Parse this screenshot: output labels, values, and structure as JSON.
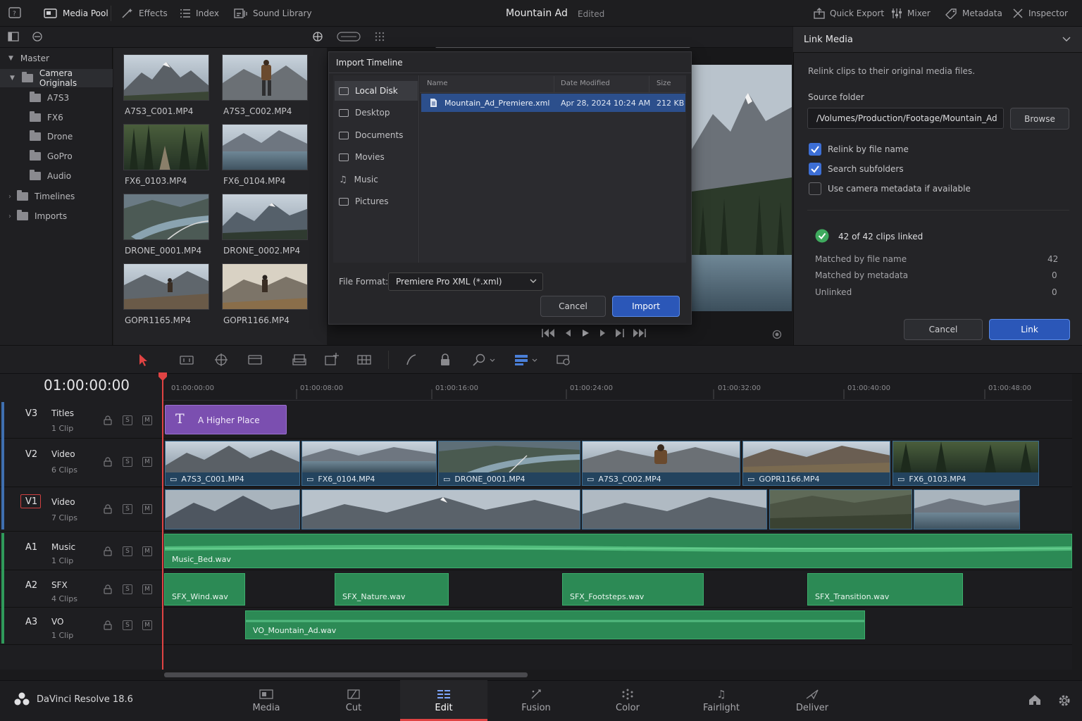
{
  "topbar": {
    "items": [
      {
        "label": "Media Pool",
        "icon": "media-pool-icon",
        "active": true
      },
      {
        "label": "Effects",
        "icon": "effects-icon"
      },
      {
        "label": "Index",
        "icon": "index-icon"
      },
      {
        "label": "Sound Library",
        "icon": "sound-library-icon"
      }
    ],
    "project_title": "Mountain Ad",
    "project_status": "Edited",
    "right_items": [
      {
        "label": "Quick Export",
        "icon": "quick-export-icon"
      },
      {
        "label": "Mixer",
        "icon": "mixer-icon"
      },
      {
        "label": "Metadata",
        "icon": "metadata-icon"
      },
      {
        "label": "Inspector",
        "icon": "inspector-icon"
      }
    ]
  },
  "bins": {
    "master": "Master",
    "items": [
      {
        "label": "Camera Originals",
        "selected": true
      },
      {
        "label": "A7S3"
      },
      {
        "label": "FX6"
      },
      {
        "label": "Drone"
      },
      {
        "label": "GoPro"
      },
      {
        "label": "Audio"
      },
      {
        "label": "Timelines"
      },
      {
        "label": "Imports"
      }
    ]
  },
  "pool": {
    "clips": [
      "A7S3_C001.MP4",
      "A7S3_C002.MP4",
      "FX6_0103.MP4",
      "FX6_0104.MP4",
      "DRONE_0001.MP4",
      "DRONE_0002.MP4",
      "GOPR1165.MP4",
      "GOPR1166.MP4"
    ]
  },
  "dialog": {
    "title": "Import Timeline",
    "locations": [
      "Local Disk",
      "Desktop",
      "Documents",
      "Movies",
      "Music",
      "Pictures"
    ],
    "columns": {
      "name": "Name",
      "date": "Date Modified",
      "size": "Size"
    },
    "file": {
      "name": "Mountain_Ad_Premiere.xml",
      "date": "Apr 28, 2024 10:24 AM",
      "size": "212 KB"
    },
    "format_label": "File Format:",
    "format_value": "Premiere Pro XML (*.xml)",
    "cancel": "Cancel",
    "import": "Import"
  },
  "link": {
    "title": "Link Media",
    "description": "Relink clips to their original media files.",
    "source_label": "Source folder",
    "source_path": "/Volumes/Production/Footage/Mountain_Ad",
    "browse": "Browse",
    "options": [
      {
        "label": "Relink by file name",
        "checked": true
      },
      {
        "label": "Search subfolders",
        "checked": true
      },
      {
        "label": "Use camera metadata if available",
        "checked": false
      }
    ],
    "status": "42 of 42 clips linked",
    "stats": [
      {
        "label": "Matched by file name",
        "value": "42"
      },
      {
        "label": "Matched by metadata",
        "value": "0"
      },
      {
        "label": "Unlinked",
        "value": "0"
      }
    ],
    "cancel": "Cancel",
    "link": "Link"
  },
  "timeline": {
    "timecode": "01:00:00:00",
    "ruler": [
      "01:00:00:00",
      "01:00:08:00",
      "01:00:16:00",
      "01:00:24:00",
      "01:00:32:00",
      "01:00:40:00",
      "01:00:48:00"
    ],
    "tracks": [
      {
        "id": "V3",
        "type": "Titles",
        "count": "1 Clip"
      },
      {
        "id": "V2",
        "type": "Video",
        "count": "6 Clips"
      },
      {
        "id": "V1",
        "type": "Video",
        "count": "7 Clips"
      },
      {
        "id": "A1",
        "type": "Music",
        "count": "1 Clip"
      },
      {
        "id": "A2",
        "type": "SFX",
        "count": "4 Clips"
      },
      {
        "id": "A3",
        "type": "VO",
        "count": "1 Clip"
      }
    ],
    "track_buttons": {
      "solo": "S",
      "mute": "M"
    },
    "title_clip": "A Higher Place",
    "title_glyph": "T",
    "v2_clips": [
      "A7S3_C001.MP4",
      "FX6_0104.MP4",
      "DRONE_0001.MP4",
      "A7S3_C002.MP4",
      "GOPR1166.MP4",
      "FX6_0103.MP4"
    ],
    "a1_clip": "Music_Bed.wav",
    "a2_clips": [
      "SFX_Wind.wav",
      "SFX_Nature.wav",
      "SFX_Footsteps.wav",
      "SFX_Transition.wav"
    ],
    "a3_clip": "VO_Mountain_Ad.wav"
  },
  "app": {
    "name": "DaVinci Resolve 18.6"
  },
  "pages": [
    {
      "label": "Media",
      "icon": "media-page-icon"
    },
    {
      "label": "Cut",
      "icon": "cut-page-icon"
    },
    {
      "label": "Edit",
      "icon": "edit-page-icon",
      "active": true
    },
    {
      "label": "Fusion",
      "icon": "fusion-page-icon"
    },
    {
      "label": "Color",
      "icon": "color-page-icon"
    },
    {
      "label": "Fairlight",
      "icon": "fairlight-page-icon"
    },
    {
      "label": "Deliver",
      "icon": "deliver-page-icon"
    }
  ],
  "colors": {
    "accent": "#2b57b8",
    "title_clip": "#7b4fb0",
    "video_clip": "#23435e",
    "audio_clip": "#2c8a55",
    "playhead": "#e04343"
  }
}
